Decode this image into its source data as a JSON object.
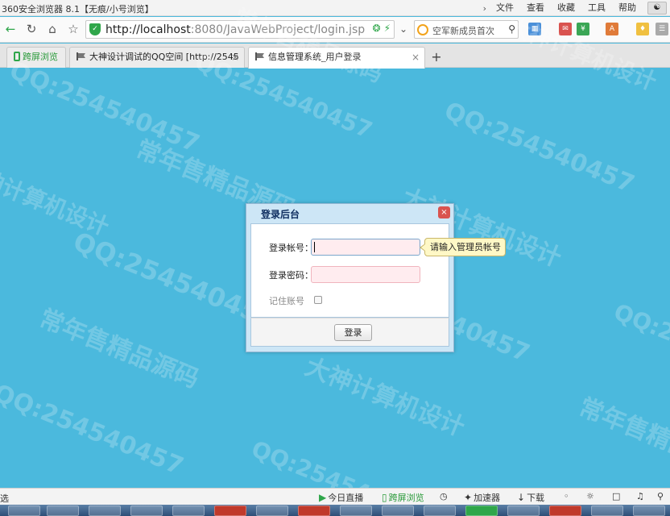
{
  "browser": {
    "window_title": "360安全浏览器 8.1【无痕/小号浏览】",
    "menus": [
      "文件",
      "查看",
      "收藏",
      "工具",
      "帮助"
    ],
    "url_host": "http://localhost",
    "url_rest": ":8080/JavaWebProject/login.jsp",
    "search_placeholder": "空军新成员首次",
    "tabs": [
      {
        "label": "跨屏浏览"
      },
      {
        "label": "大神设计调试的QQ空间 [http://2545",
        "close": "×"
      },
      {
        "label": "信息管理系统_用户登录",
        "close": "×"
      }
    ],
    "new_tab": "+"
  },
  "watermarks": [
    "QQ:254540457",
    "常年售精品源码",
    "大神计算机设计"
  ],
  "dialog": {
    "title": "登录后台",
    "close": "×",
    "username_label": "登录帐号：",
    "password_label": "登录密码：",
    "remember_label": "记住账号",
    "tooltip": "请输入管理员帐号",
    "login_button": "登录"
  },
  "statusbar": {
    "left_text": "选",
    "live": "今日直播",
    "cross_screen": "跨屏浏览",
    "accelerator": "加速器",
    "download": "下载"
  },
  "colors": {
    "page_background": "#4bb9dd",
    "dialog_header": "#cde6f6",
    "input_background": "#ffecef",
    "tooltip_background": "#fff8c6",
    "accent_green": "#2fa64a"
  }
}
